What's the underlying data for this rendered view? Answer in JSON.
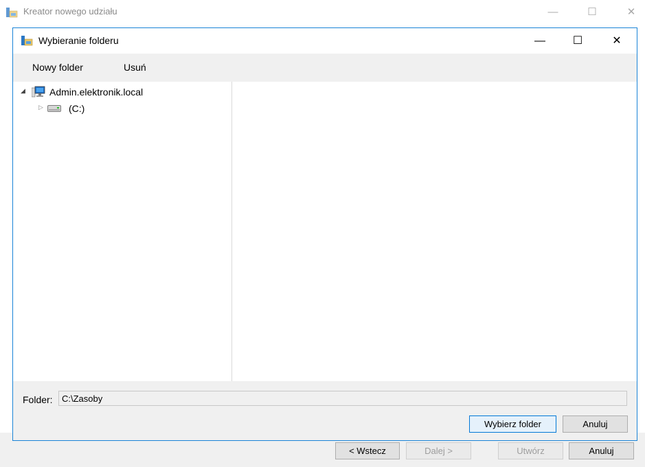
{
  "wizard": {
    "title": "Kreator nowego udziału",
    "controls": {
      "minimize": "—",
      "maximize": "☐",
      "close": "✕"
    },
    "buttons": {
      "back": "< Wstecz",
      "next": "Dalej >",
      "create": "Utwórz",
      "cancel": "Anuluj"
    }
  },
  "dialog": {
    "title": "Wybieranie folderu",
    "controls": {
      "minimize": "—",
      "maximize": "☐",
      "close": "✕"
    },
    "toolbar": {
      "new_folder": "Nowy folder",
      "delete": "Usuń"
    },
    "tree": {
      "root": {
        "label": "Admin.elektronik.local",
        "expanded": true,
        "icon": "computer-icon"
      },
      "children": [
        {
          "label": "(C:)",
          "expanded": false,
          "icon": "drive-icon"
        }
      ]
    },
    "folder_label": "Folder:",
    "folder_value": "C:\\Zasoby",
    "buttons": {
      "select_folder": "Wybierz folder",
      "cancel": "Anuluj"
    }
  },
  "colors": {
    "dialog_border": "#1883d7",
    "panel_background": "#f0f0f0",
    "focus_accent": "#0078d7"
  }
}
